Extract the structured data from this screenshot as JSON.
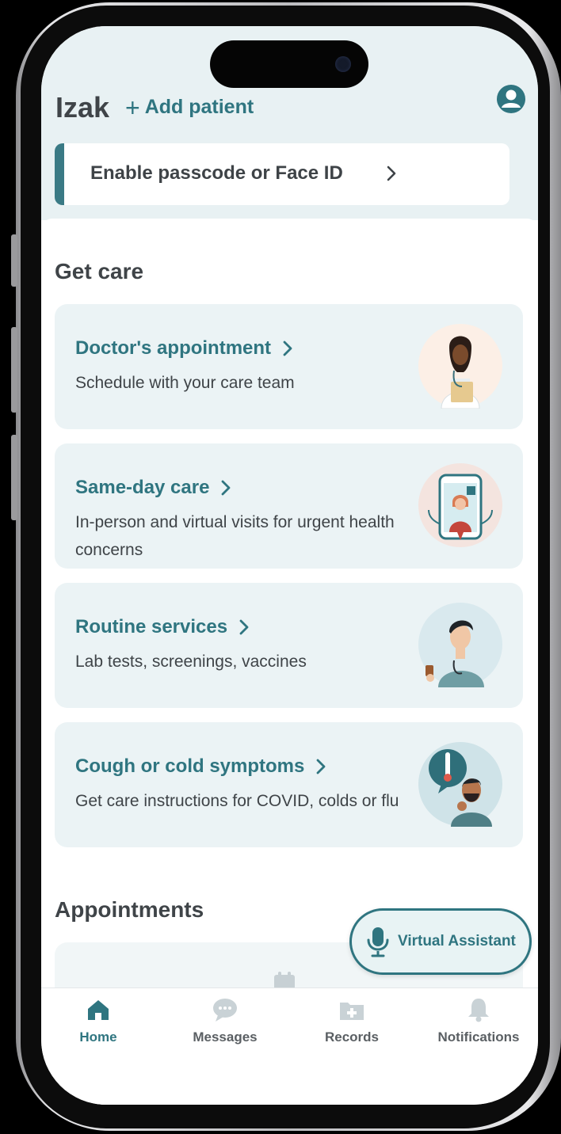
{
  "header": {
    "patient_name": "Izak",
    "add_patient_label": "Add patient",
    "passcode_banner_label": "Enable passcode or Face ID"
  },
  "get_care": {
    "title": "Get care",
    "cards": [
      {
        "title": "Doctor's appointment",
        "description": "Schedule with your care team",
        "icon": "doctor-illustration"
      },
      {
        "title": "Same-day care",
        "description": "In-person and virtual visits for urgent health concerns",
        "icon": "virtual-visit-illustration"
      },
      {
        "title": "Routine services",
        "description": "Lab tests, screenings, vaccines",
        "icon": "nurse-illustration"
      },
      {
        "title": "Cough or cold symptoms",
        "description": "Get care instructions for COVID, colds or flu",
        "icon": "sick-patient-illustration"
      }
    ]
  },
  "appointments": {
    "title": "Appointments"
  },
  "virtual_assistant": {
    "label": "Virtual Assistant"
  },
  "bottom_nav": {
    "items": [
      {
        "label": "Home",
        "icon": "home-icon",
        "active": true
      },
      {
        "label": "Messages",
        "icon": "chat-bubble-icon",
        "active": false
      },
      {
        "label": "Records",
        "icon": "medical-folder-icon",
        "active": false
      },
      {
        "label": "Notifications",
        "icon": "bell-icon",
        "active": false
      }
    ]
  },
  "colors": {
    "accent": "#2f7580",
    "header_bg": "#e8f1f3",
    "card_bg": "#ebf3f5",
    "text": "#3f4448"
  }
}
